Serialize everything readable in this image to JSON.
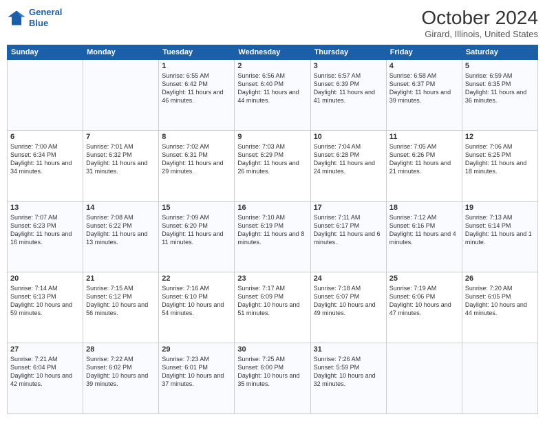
{
  "header": {
    "logo_line1": "General",
    "logo_line2": "Blue",
    "month": "October 2024",
    "location": "Girard, Illinois, United States"
  },
  "days_of_week": [
    "Sunday",
    "Monday",
    "Tuesday",
    "Wednesday",
    "Thursday",
    "Friday",
    "Saturday"
  ],
  "weeks": [
    [
      {
        "num": "",
        "info": ""
      },
      {
        "num": "",
        "info": ""
      },
      {
        "num": "1",
        "info": "Sunrise: 6:55 AM\nSunset: 6:42 PM\nDaylight: 11 hours and 46 minutes."
      },
      {
        "num": "2",
        "info": "Sunrise: 6:56 AM\nSunset: 6:40 PM\nDaylight: 11 hours and 44 minutes."
      },
      {
        "num": "3",
        "info": "Sunrise: 6:57 AM\nSunset: 6:39 PM\nDaylight: 11 hours and 41 minutes."
      },
      {
        "num": "4",
        "info": "Sunrise: 6:58 AM\nSunset: 6:37 PM\nDaylight: 11 hours and 39 minutes."
      },
      {
        "num": "5",
        "info": "Sunrise: 6:59 AM\nSunset: 6:35 PM\nDaylight: 11 hours and 36 minutes."
      }
    ],
    [
      {
        "num": "6",
        "info": "Sunrise: 7:00 AM\nSunset: 6:34 PM\nDaylight: 11 hours and 34 minutes."
      },
      {
        "num": "7",
        "info": "Sunrise: 7:01 AM\nSunset: 6:32 PM\nDaylight: 11 hours and 31 minutes."
      },
      {
        "num": "8",
        "info": "Sunrise: 7:02 AM\nSunset: 6:31 PM\nDaylight: 11 hours and 29 minutes."
      },
      {
        "num": "9",
        "info": "Sunrise: 7:03 AM\nSunset: 6:29 PM\nDaylight: 11 hours and 26 minutes."
      },
      {
        "num": "10",
        "info": "Sunrise: 7:04 AM\nSunset: 6:28 PM\nDaylight: 11 hours and 24 minutes."
      },
      {
        "num": "11",
        "info": "Sunrise: 7:05 AM\nSunset: 6:26 PM\nDaylight: 11 hours and 21 minutes."
      },
      {
        "num": "12",
        "info": "Sunrise: 7:06 AM\nSunset: 6:25 PM\nDaylight: 11 hours and 18 minutes."
      }
    ],
    [
      {
        "num": "13",
        "info": "Sunrise: 7:07 AM\nSunset: 6:23 PM\nDaylight: 11 hours and 16 minutes."
      },
      {
        "num": "14",
        "info": "Sunrise: 7:08 AM\nSunset: 6:22 PM\nDaylight: 11 hours and 13 minutes."
      },
      {
        "num": "15",
        "info": "Sunrise: 7:09 AM\nSunset: 6:20 PM\nDaylight: 11 hours and 11 minutes."
      },
      {
        "num": "16",
        "info": "Sunrise: 7:10 AM\nSunset: 6:19 PM\nDaylight: 11 hours and 8 minutes."
      },
      {
        "num": "17",
        "info": "Sunrise: 7:11 AM\nSunset: 6:17 PM\nDaylight: 11 hours and 6 minutes."
      },
      {
        "num": "18",
        "info": "Sunrise: 7:12 AM\nSunset: 6:16 PM\nDaylight: 11 hours and 4 minutes."
      },
      {
        "num": "19",
        "info": "Sunrise: 7:13 AM\nSunset: 6:14 PM\nDaylight: 11 hours and 1 minute."
      }
    ],
    [
      {
        "num": "20",
        "info": "Sunrise: 7:14 AM\nSunset: 6:13 PM\nDaylight: 10 hours and 59 minutes."
      },
      {
        "num": "21",
        "info": "Sunrise: 7:15 AM\nSunset: 6:12 PM\nDaylight: 10 hours and 56 minutes."
      },
      {
        "num": "22",
        "info": "Sunrise: 7:16 AM\nSunset: 6:10 PM\nDaylight: 10 hours and 54 minutes."
      },
      {
        "num": "23",
        "info": "Sunrise: 7:17 AM\nSunset: 6:09 PM\nDaylight: 10 hours and 51 minutes."
      },
      {
        "num": "24",
        "info": "Sunrise: 7:18 AM\nSunset: 6:07 PM\nDaylight: 10 hours and 49 minutes."
      },
      {
        "num": "25",
        "info": "Sunrise: 7:19 AM\nSunset: 6:06 PM\nDaylight: 10 hours and 47 minutes."
      },
      {
        "num": "26",
        "info": "Sunrise: 7:20 AM\nSunset: 6:05 PM\nDaylight: 10 hours and 44 minutes."
      }
    ],
    [
      {
        "num": "27",
        "info": "Sunrise: 7:21 AM\nSunset: 6:04 PM\nDaylight: 10 hours and 42 minutes."
      },
      {
        "num": "28",
        "info": "Sunrise: 7:22 AM\nSunset: 6:02 PM\nDaylight: 10 hours and 39 minutes."
      },
      {
        "num": "29",
        "info": "Sunrise: 7:23 AM\nSunset: 6:01 PM\nDaylight: 10 hours and 37 minutes."
      },
      {
        "num": "30",
        "info": "Sunrise: 7:25 AM\nSunset: 6:00 PM\nDaylight: 10 hours and 35 minutes."
      },
      {
        "num": "31",
        "info": "Sunrise: 7:26 AM\nSunset: 5:59 PM\nDaylight: 10 hours and 32 minutes."
      },
      {
        "num": "",
        "info": ""
      },
      {
        "num": "",
        "info": ""
      }
    ]
  ]
}
